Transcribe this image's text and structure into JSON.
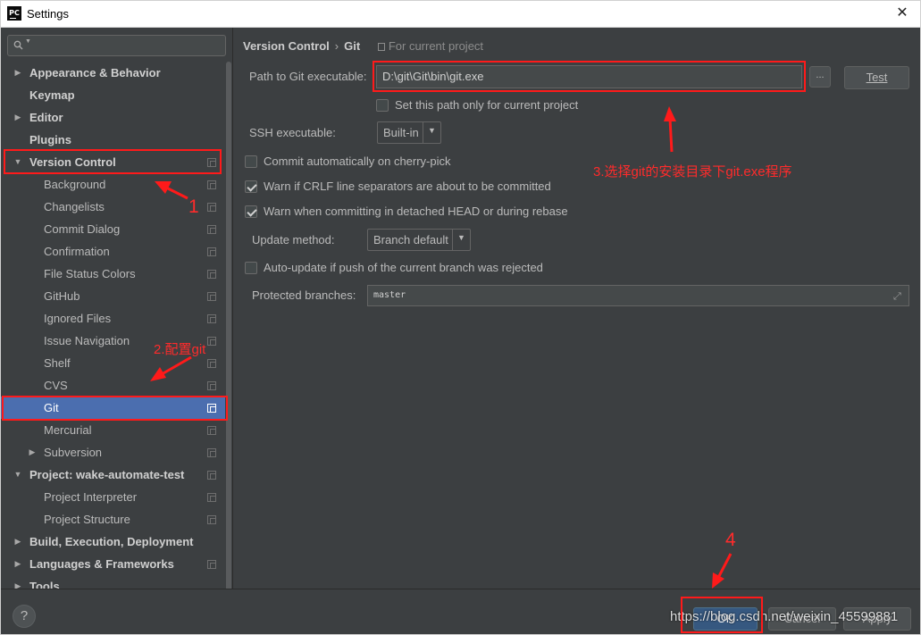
{
  "window": {
    "title": "Settings",
    "app_icon_text": "PC",
    "close_symbol": "✕"
  },
  "search": {
    "placeholder": "",
    "icon": "search-icon"
  },
  "tree": [
    {
      "label": "Appearance & Behavior",
      "level": 0,
      "bold": true,
      "arrow": "▶",
      "page_icon": false,
      "selected": false
    },
    {
      "label": "Keymap",
      "level": 0,
      "bold": true,
      "arrow": "",
      "page_icon": false,
      "selected": false
    },
    {
      "label": "Editor",
      "level": 0,
      "bold": true,
      "arrow": "▶",
      "page_icon": false,
      "selected": false
    },
    {
      "label": "Plugins",
      "level": 0,
      "bold": true,
      "arrow": "",
      "page_icon": false,
      "selected": false
    },
    {
      "label": "Version Control",
      "level": 0,
      "bold": true,
      "arrow": "▼",
      "page_icon": true,
      "selected": false
    },
    {
      "label": "Background",
      "level": 1,
      "bold": false,
      "arrow": "",
      "page_icon": true,
      "selected": false
    },
    {
      "label": "Changelists",
      "level": 1,
      "bold": false,
      "arrow": "",
      "page_icon": true,
      "selected": false
    },
    {
      "label": "Commit Dialog",
      "level": 1,
      "bold": false,
      "arrow": "",
      "page_icon": true,
      "selected": false
    },
    {
      "label": "Confirmation",
      "level": 1,
      "bold": false,
      "arrow": "",
      "page_icon": true,
      "selected": false
    },
    {
      "label": "File Status Colors",
      "level": 1,
      "bold": false,
      "arrow": "",
      "page_icon": true,
      "selected": false
    },
    {
      "label": "GitHub",
      "level": 1,
      "bold": false,
      "arrow": "",
      "page_icon": true,
      "selected": false
    },
    {
      "label": "Ignored Files",
      "level": 1,
      "bold": false,
      "arrow": "",
      "page_icon": true,
      "selected": false
    },
    {
      "label": "Issue Navigation",
      "level": 1,
      "bold": false,
      "arrow": "",
      "page_icon": true,
      "selected": false
    },
    {
      "label": "Shelf",
      "level": 1,
      "bold": false,
      "arrow": "",
      "page_icon": true,
      "selected": false
    },
    {
      "label": "CVS",
      "level": 1,
      "bold": false,
      "arrow": "",
      "page_icon": true,
      "selected": false
    },
    {
      "label": "Git",
      "level": 1,
      "bold": false,
      "arrow": "",
      "page_icon": true,
      "selected": true
    },
    {
      "label": "Mercurial",
      "level": 1,
      "bold": false,
      "arrow": "",
      "page_icon": true,
      "selected": false
    },
    {
      "label": "Subversion",
      "level": 1,
      "bold": false,
      "arrow": "▶",
      "page_icon": true,
      "selected": false
    },
    {
      "label": "Project: wake-automate-test",
      "level": 0,
      "bold": true,
      "arrow": "▼",
      "page_icon": true,
      "selected": false
    },
    {
      "label": "Project Interpreter",
      "level": 1,
      "bold": false,
      "arrow": "",
      "page_icon": true,
      "selected": false
    },
    {
      "label": "Project Structure",
      "level": 1,
      "bold": false,
      "arrow": "",
      "page_icon": true,
      "selected": false
    },
    {
      "label": "Build, Execution, Deployment",
      "level": 0,
      "bold": true,
      "arrow": "▶",
      "page_icon": false,
      "selected": false
    },
    {
      "label": "Languages & Frameworks",
      "level": 0,
      "bold": true,
      "arrow": "▶",
      "page_icon": true,
      "selected": false
    },
    {
      "label": "Tools",
      "level": 0,
      "bold": true,
      "arrow": "▶",
      "page_icon": false,
      "selected": false
    }
  ],
  "breadcrumb": {
    "parent": "Version Control",
    "separator": "›",
    "current": "Git",
    "scope": "For current project"
  },
  "git": {
    "path_label": "Path to Git executable:",
    "path_value": "D:\\git\\Git\\bin\\git.exe",
    "browse_label": "...",
    "test_label": "Test",
    "path_only_project_label": "Set this path only for current project",
    "path_only_project_checked": false,
    "ssh_label": "SSH executable:",
    "ssh_value": "Built-in",
    "cherry_pick_label": "Commit automatically on cherry-pick",
    "cherry_pick_checked": false,
    "crlf_label": "Warn if CRLF line separators are about to be committed",
    "crlf_checked": true,
    "detached_label": "Warn when committing in detached HEAD or during rebase",
    "detached_checked": true,
    "update_method_label": "Update method:",
    "update_method_value": "Branch default",
    "auto_update_label": "Auto-update if push of the current branch was rejected",
    "auto_update_checked": false,
    "protected_label": "Protected branches:",
    "protected_value": "master"
  },
  "footer": {
    "help_label": "?",
    "ok_label": "OK",
    "cancel_label": "Cancel",
    "apply_label": "Apply"
  },
  "watermark": "https://blog.csdn.net/weixin_45599881",
  "annotations": {
    "a1": "1",
    "a2": "2.配置git",
    "a3": "3.选择git的安装目录下git.exe程序",
    "a4": "4"
  },
  "colors": {
    "background": "#3c3f41",
    "selection": "#4b6eaf",
    "annotation_red": "#ff1a1a",
    "ok_button": "#365880"
  }
}
